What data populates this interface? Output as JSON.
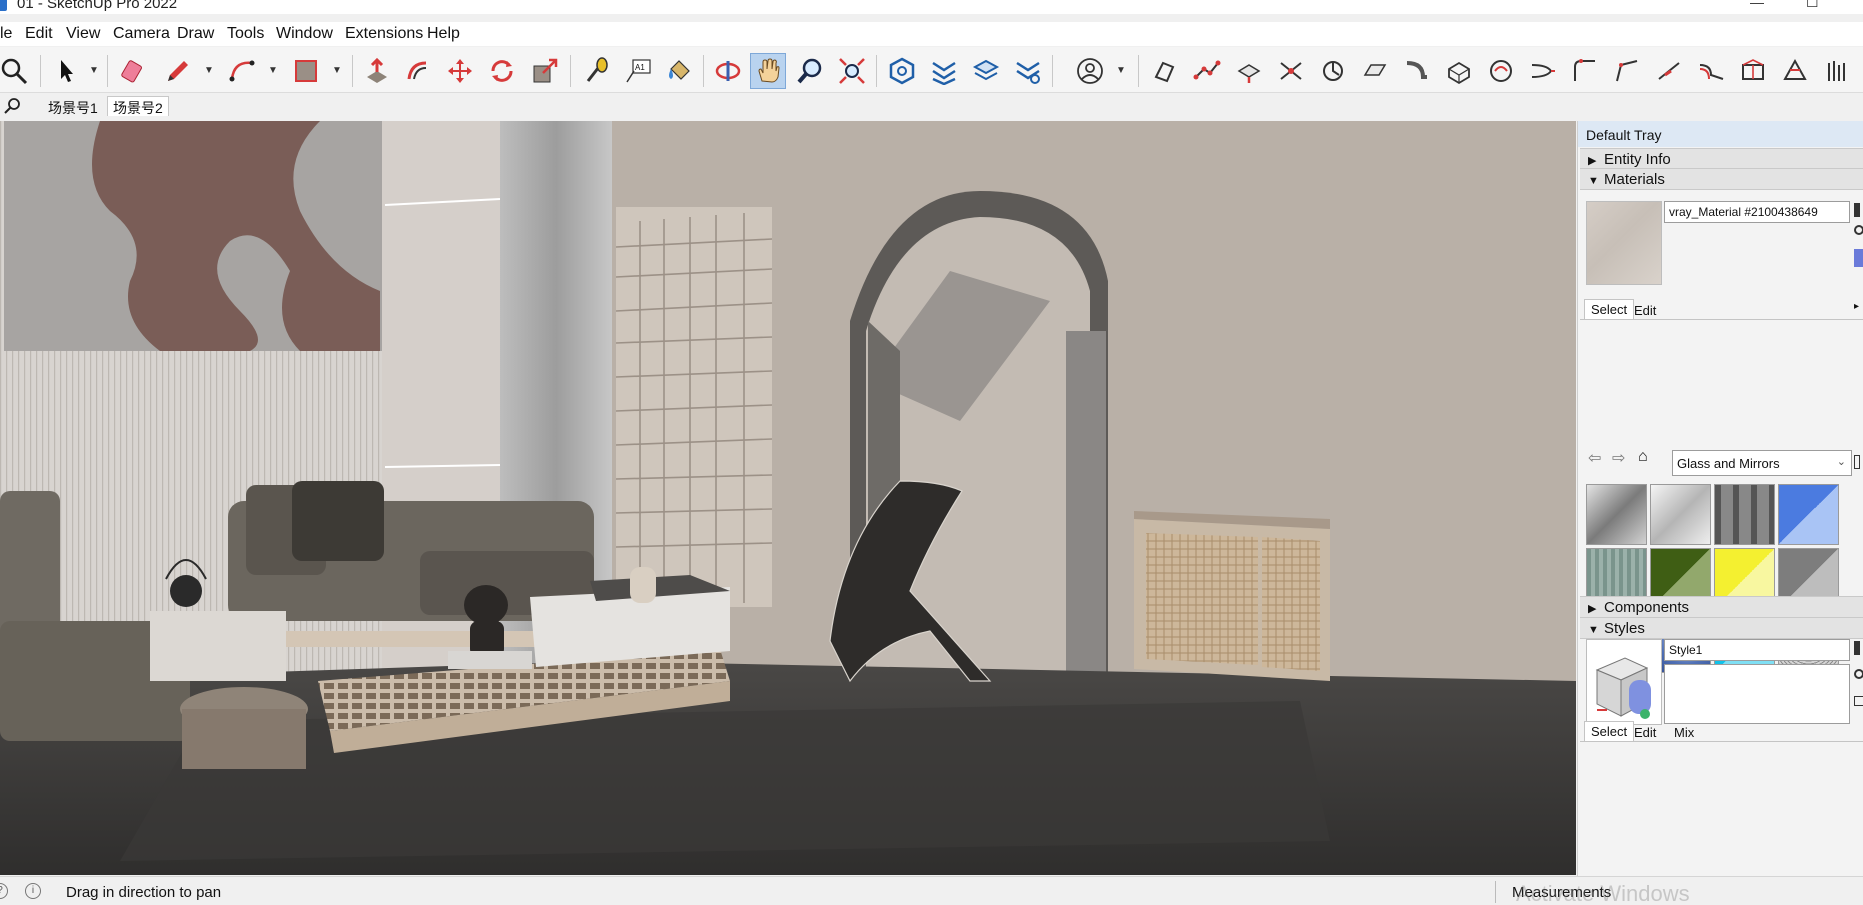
{
  "window": {
    "title": "01 - SketchUp Pro 2022"
  },
  "menu": [
    "le",
    "Edit",
    "View",
    "Camera",
    "Draw",
    "Tools",
    "Window",
    "Extensions",
    "Help"
  ],
  "toolbar": {
    "buttons": [
      "select-tool",
      "eraser-tool",
      "pencil-tool",
      "arc-tool",
      "rectangle-tool",
      "push-pull-tool",
      "offset-tool",
      "move-tool",
      "rotate-tool",
      "scale-tool",
      "tape-measure-tool",
      "text-tool",
      "paint-bucket-tool",
      "orbit-tool",
      "pan-tool",
      "zoom-tool",
      "zoom-extents-tool",
      "warehouse-button",
      "extension-warehouse-button",
      "layout-button",
      "extension-manager-button",
      "account-button"
    ],
    "active": "pan-tool",
    "text_label": "A1"
  },
  "scenes": {
    "tabs": [
      "场景号1",
      "场景号2"
    ],
    "active_index": 1
  },
  "tray": {
    "title": "Default Tray",
    "panels": {
      "entity_info": "Entity Info",
      "materials": "Materials",
      "components": "Components",
      "styles": "Styles"
    },
    "materials": {
      "name": "vray_Material #2100438649",
      "tabs": [
        "Select",
        "Edit"
      ],
      "library": "Glass and Mirrors",
      "swatch_colors": [
        "#9a9a9a",
        "#c9c9c9",
        "#6e6e6e",
        "#5b86e5",
        "#8aa39a",
        "#4b6a1f",
        "#f2f02a",
        "#8f8f8f",
        "#bfe3f3",
        "#5a79b8",
        "#13c6ea",
        "#a9a9a9"
      ]
    },
    "styles": {
      "name": "Style1",
      "tabs": [
        "Select",
        "Edit",
        "Mix"
      ]
    }
  },
  "status": {
    "hint": "Drag in direction to pan",
    "measurements_label": "Measurements",
    "watermark": "Activate Windows"
  }
}
